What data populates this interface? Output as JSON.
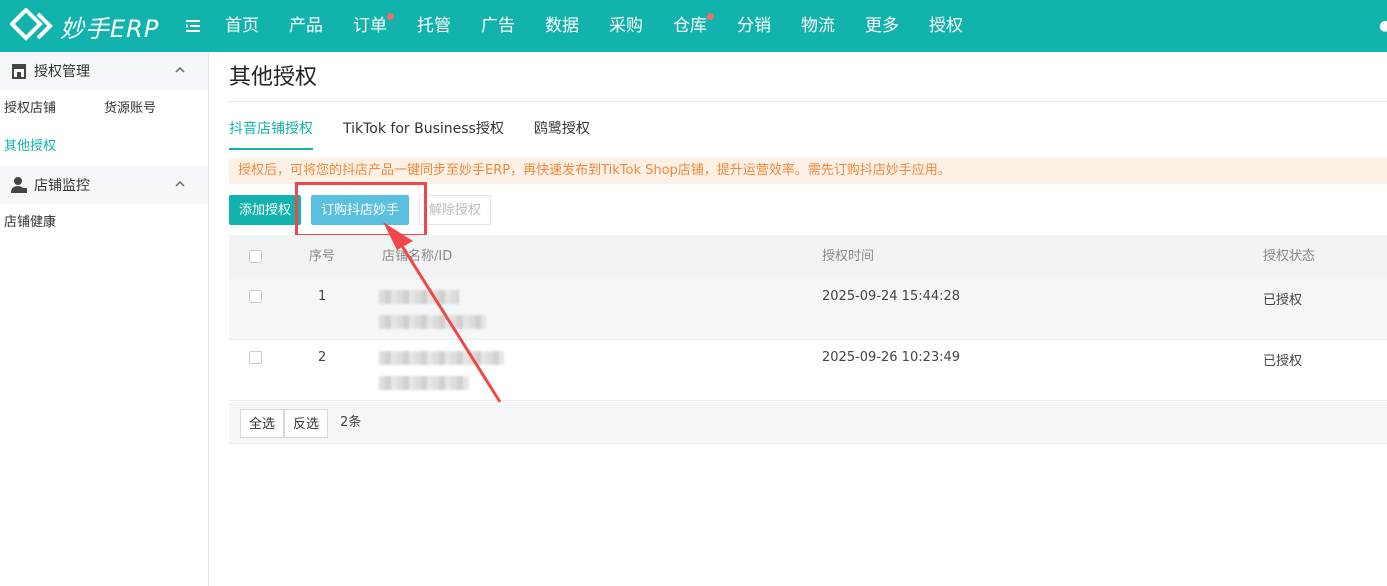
{
  "brand": {
    "name": "妙手ERP"
  },
  "nav": [
    {
      "label": "首页",
      "dot": false
    },
    {
      "label": "产品",
      "dot": false
    },
    {
      "label": "订单",
      "dot": true
    },
    {
      "label": "托管",
      "dot": false
    },
    {
      "label": "广告",
      "dot": false
    },
    {
      "label": "数据",
      "dot": false
    },
    {
      "label": "采购",
      "dot": false
    },
    {
      "label": "仓库",
      "dot": true
    },
    {
      "label": "分销",
      "dot": false
    },
    {
      "label": "物流",
      "dot": false
    },
    {
      "label": "更多",
      "dot": false
    },
    {
      "label": "授权",
      "dot": false
    }
  ],
  "sidebar": {
    "groups": [
      {
        "title": "授权管理",
        "icon": "store-icon",
        "links": [
          "授权店铺",
          "货源账号",
          "其他授权"
        ],
        "active": "其他授权"
      },
      {
        "title": "店铺监控",
        "icon": "user-monitor-icon",
        "links": [
          "店铺健康"
        ],
        "active": ""
      }
    ]
  },
  "page": {
    "title": "其他授权",
    "tabs": [
      "抖音店铺授权",
      "TikTok for Business授权",
      "鸥鹭授权"
    ],
    "active_tab": 0,
    "notice": "授权后，可将您的抖店产品一键同步至妙手ERP，再快速发布到TikTok Shop店铺，提升运营效率。需先订购抖店妙手应用。",
    "buttons": {
      "add": "添加授权",
      "subscribe": "订购抖店妙手",
      "remove": "解除授权"
    }
  },
  "table": {
    "headers": {
      "index": "序号",
      "name": "店铺名称/ID",
      "time": "授权时间",
      "status": "授权状态"
    },
    "rows": [
      {
        "index": "1",
        "time": "2025-09-24 15:44:28",
        "status": "已授权"
      },
      {
        "index": "2",
        "time": "2025-09-26 10:23:49",
        "status": "已授权"
      }
    ],
    "footer": {
      "select_all": "全选",
      "invert": "反选",
      "count": "2条"
    }
  },
  "colors": {
    "primary": "#12b3ad",
    "info": "#5bc0de",
    "alert": "#f04848",
    "notice_text": "#f0883a"
  }
}
